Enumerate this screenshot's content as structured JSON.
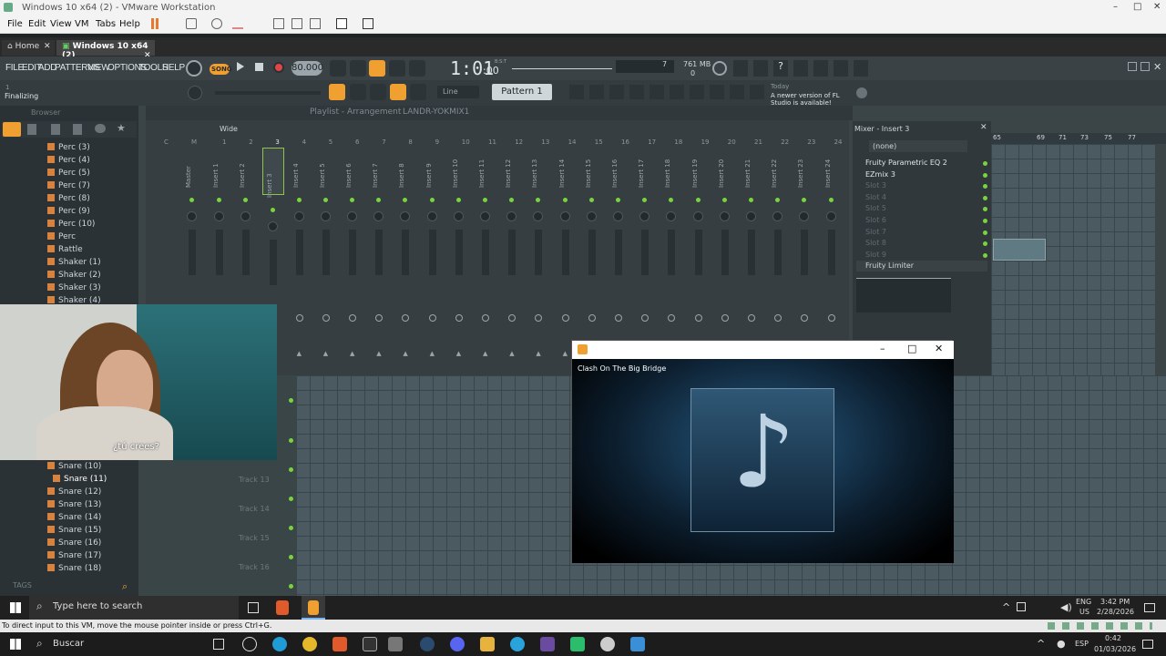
{
  "vm": {
    "window_title": "Windows 10 x64 (2) - VMware Workstation",
    "menu": [
      "File",
      "Edit",
      "View",
      "VM",
      "Tabs",
      "Help"
    ],
    "tabs": [
      {
        "label": "Home"
      },
      {
        "label": "Windows 10 x64 (2)"
      }
    ],
    "status_text": "To direct input to this VM, move the mouse pointer inside or press Ctrl+G."
  },
  "fl": {
    "menu": [
      "FILE",
      "EDIT",
      "ADD",
      "PATTERNS",
      "VIEW",
      "OPTIONS",
      "TOOLS",
      "HELP"
    ],
    "song_label": "SONG",
    "tempo": "80.000",
    "time": "1:01",
    "time_sub": ":00",
    "time_units": "B:S:T",
    "cpu": "7",
    "memory": "761 MB",
    "voices": "0",
    "hint_counter": "1",
    "hint_text": "Finalizing",
    "snap": "Line",
    "pattern": "Pattern 1",
    "news_date": "Today",
    "news_text": "A newer version of FL Studio is available!",
    "browser_title": "Browser",
    "playlist_title": "Playlist - Arrangement",
    "playlist_path": "LANDR-YOKMIX1",
    "mixer_title": "Mixer - Insert 3",
    "mixer_view": "Wide",
    "browser_items": [
      "Perc (3)",
      "Perc (4)",
      "Perc (5)",
      "Perc (7)",
      "Perc (8)",
      "Perc (9)",
      "Perc (10)",
      "Perc",
      "Rattle",
      "Shaker (1)",
      "Shaker (2)",
      "Shaker (3)",
      "Shaker (4)"
    ],
    "browser_items_lower": [
      "Snare (10)",
      "Snare (11)",
      "Snare (12)",
      "Snare (13)",
      "Snare (14)",
      "Snare (15)",
      "Snare (16)",
      "Snare (17)",
      "Snare (18)"
    ],
    "tags_label": "TAGS",
    "mixer_channels": [
      "Master",
      "Insert 1",
      "Insert 2",
      "Insert 3",
      "Insert 4",
      "Insert 5",
      "Insert 6",
      "Insert 7",
      "Insert 8",
      "Insert 9",
      "Insert 10",
      "Insert 11",
      "Insert 12",
      "Insert 13",
      "Insert 14",
      "Insert 15",
      "Insert 16",
      "Insert 17",
      "Insert 18",
      "Insert 19",
      "Insert 20",
      "Insert 21",
      "Insert 22",
      "Insert 23",
      "Insert 24"
    ],
    "mixer_numbers": [
      "C",
      "M",
      "1",
      "2",
      "3",
      "4",
      "5",
      "6",
      "7",
      "8",
      "9",
      "10",
      "11",
      "12",
      "13",
      "14",
      "15",
      "16",
      "17",
      "18",
      "19",
      "20",
      "21",
      "22",
      "23",
      "24"
    ],
    "fx_input": "(none)",
    "fx_slots": [
      "Fruity Parametric EQ 2",
      "EZmix 3",
      "Slot 3",
      "Slot 4",
      "Slot 5",
      "Slot 6",
      "Slot 7",
      "Slot 8",
      "Slot 9"
    ],
    "fx_limiter": "Fruity Limiter",
    "timeline_bars": [
      "65",
      "69",
      "71",
      "73",
      "75",
      "77"
    ],
    "tracks": [
      "Track 13",
      "Track 14",
      "Track 15",
      "Track 16"
    ]
  },
  "webcam": {
    "subtitle": "¿tú crees?"
  },
  "media_player": {
    "title": "Clash On The Big Bridge"
  },
  "vm_taskbar": {
    "search_placeholder": "Type here to search",
    "lang": "ENG",
    "region": "US",
    "time": "3:42 PM",
    "date": "2/28/2026"
  },
  "host_taskbar": {
    "search_placeholder": "Buscar",
    "lang": "ESP",
    "time": "0:42",
    "date": "01/03/2026"
  },
  "colors": {
    "accent_green": "#78d43d",
    "accent_orange": "#f0a030",
    "fl_bg": "#3b4447"
  }
}
